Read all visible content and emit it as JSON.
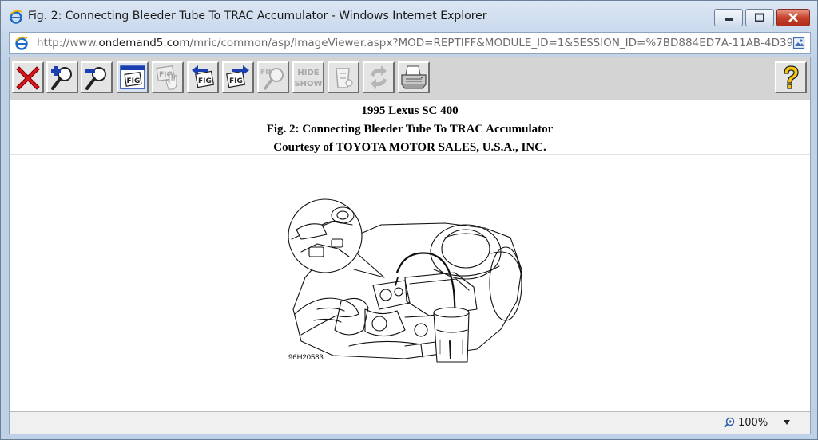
{
  "window": {
    "title": "Fig. 2: Connecting Bleeder Tube To TRAC Accumulator - Windows Internet Explorer"
  },
  "address": {
    "prefix": "http://www.",
    "host": "ondemand5.com",
    "path": "/mric/common/asp/ImageViewer.aspx?MOD=REPTIFF&MODULE_ID=1&SESSION_ID=%7BD884ED7A-11AB-4D39"
  },
  "toolbar": {
    "buttons": [
      {
        "name": "close-figure",
        "icon": "red-x-icon",
        "enabled": true
      },
      {
        "name": "zoom-in",
        "icon": "magnifier-plus-icon",
        "enabled": true
      },
      {
        "name": "zoom-out",
        "icon": "magnifier-minus-icon",
        "enabled": true
      },
      {
        "name": "fit-figure",
        "icon": "fig-window-icon",
        "enabled": true,
        "label": "FIG"
      },
      {
        "name": "pan-figure",
        "icon": "fig-hand-icon",
        "enabled": false,
        "label": "FIG"
      },
      {
        "name": "previous-figure",
        "icon": "fig-back-arrow-icon",
        "enabled": true,
        "label": "FIG"
      },
      {
        "name": "next-figure",
        "icon": "fig-forward-arrow-icon",
        "enabled": true,
        "label": "FIG"
      },
      {
        "name": "find",
        "icon": "find-magnifier-icon",
        "enabled": false,
        "label": "FIND"
      },
      {
        "name": "hide-show",
        "icon": "hide-show-icon",
        "enabled": false,
        "label_top": "HIDE",
        "label_bottom": "SHOW"
      },
      {
        "name": "erase",
        "icon": "eraser-icon",
        "enabled": false
      },
      {
        "name": "rotate",
        "icon": "rotate-arrows-icon",
        "enabled": false
      },
      {
        "name": "print",
        "icon": "printer-icon",
        "enabled": true
      }
    ],
    "help_icon": "help-question-icon"
  },
  "document": {
    "vehicle": "1995 Lexus SC 400",
    "figure_title": "Fig. 2: Connecting Bleeder Tube To TRAC Accumulator",
    "courtesy": "Courtesy of TOYOTA MOTOR SALES, U.S.A., INC.",
    "figure_code": "96H20583"
  },
  "status": {
    "zoom": "100%"
  },
  "colors": {
    "close_red": "#c4432d",
    "ie_blue": "#1b6ac9",
    "toolbar_gray": "#d4d4d4"
  }
}
